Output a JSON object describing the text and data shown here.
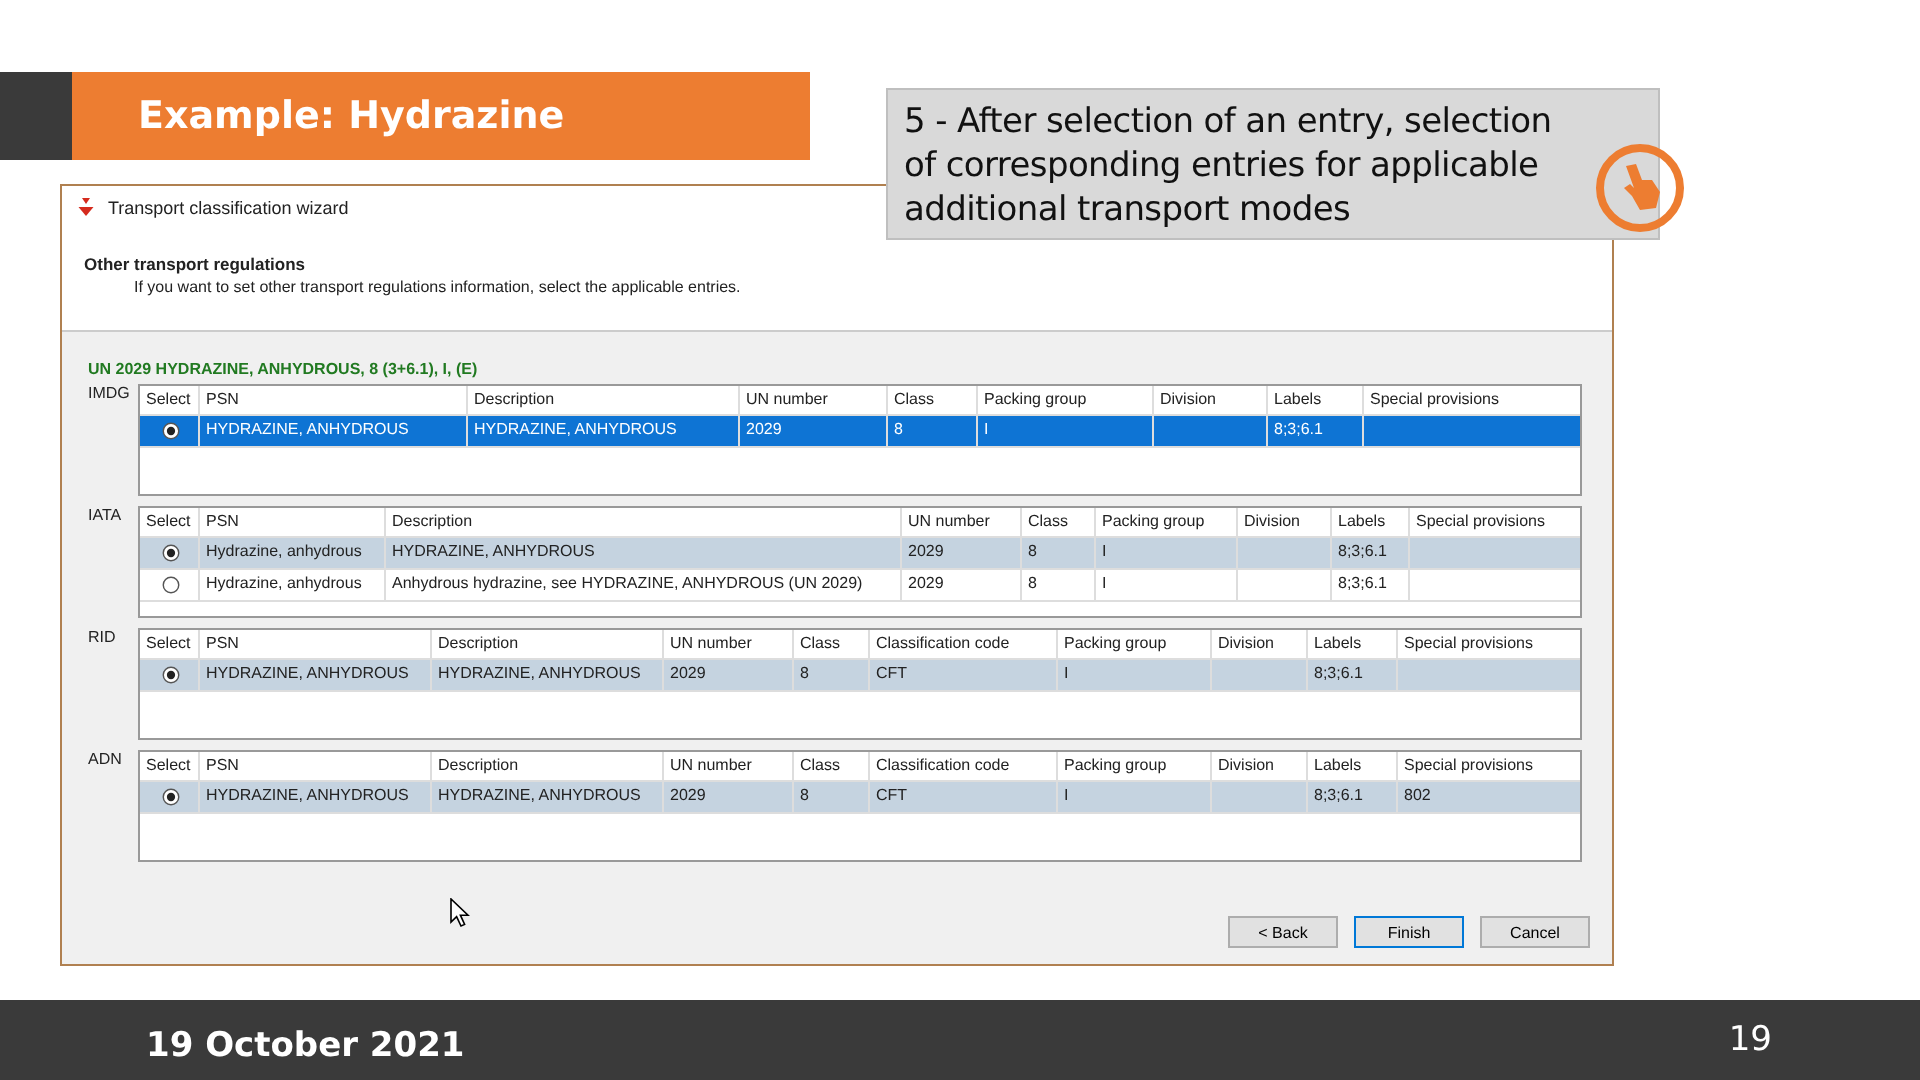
{
  "slide": {
    "title": "Example: Hydrazine",
    "callout": "5 - After selection of an entry, selection of corresponding entries for applicable additional transport modes",
    "date": "19 October 2021",
    "page_number": "19"
  },
  "wizard": {
    "title": "Transport classification wizard",
    "heading": "Other transport regulations",
    "instruction": "If you want to set other transport regulations information, select the applicable entries.",
    "entry": "UN 2029 HYDRAZINE, ANHYDROUS, 8 (3+6.1), I, (E)",
    "tables": [
      {
        "label": "IMDG",
        "focused": true,
        "select_column": "Select",
        "columns": [
          "PSN",
          "Description",
          "UN number",
          "Class",
          "Packing group",
          "Division",
          "Labels",
          "Special provisions"
        ],
        "rows": [
          {
            "selected": true,
            "cells": [
              "HYDRAZINE, ANHYDROUS",
              "HYDRAZINE, ANHYDROUS",
              "2029",
              "8",
              "I",
              null,
              "8;3;6.1",
              null
            ]
          }
        ]
      },
      {
        "label": "IATA",
        "focused": false,
        "select_column": "Select",
        "columns": [
          "PSN",
          "Description",
          "UN number",
          "Class",
          "Packing group",
          "Division",
          "Labels",
          "Special provisions"
        ],
        "rows": [
          {
            "selected": true,
            "cells": [
              "Hydrazine, anhydrous",
              "HYDRAZINE, ANHYDROUS",
              "2029",
              "8",
              "I",
              null,
              "8;3;6.1",
              null
            ]
          },
          {
            "selected": false,
            "cells": [
              "Hydrazine, anhydrous",
              "Anhydrous hydrazine, see HYDRAZINE, ANHYDROUS (UN 2029)",
              "2029",
              "8",
              "I",
              null,
              "8;3;6.1",
              null
            ]
          }
        ]
      },
      {
        "label": "RID",
        "focused": false,
        "select_column": "Select",
        "columns": [
          "PSN",
          "Description",
          "UN number",
          "Class",
          "Classification code",
          "Packing group",
          "Division",
          "Labels",
          "Special provisions"
        ],
        "rows": [
          {
            "selected": true,
            "cells": [
              "HYDRAZINE, ANHYDROUS",
              "HYDRAZINE, ANHYDROUS",
              "2029",
              "8",
              "CFT",
              "I",
              null,
              "8;3;6.1",
              null
            ]
          }
        ]
      },
      {
        "label": "ADN",
        "focused": false,
        "select_column": "Select",
        "columns": [
          "PSN",
          "Description",
          "UN number",
          "Class",
          "Classification code",
          "Packing group",
          "Division",
          "Labels",
          "Special provisions"
        ],
        "rows": [
          {
            "selected": true,
            "cells": [
              "HYDRAZINE, ANHYDROUS",
              "HYDRAZINE, ANHYDROUS",
              "2029",
              "8",
              "CFT",
              "I",
              null,
              "8;3;6.1",
              "802"
            ]
          }
        ]
      }
    ],
    "buttons": [
      {
        "label": "< Back",
        "default": false
      },
      {
        "label": "Finish",
        "default": true
      },
      {
        "label": "Cancel",
        "default": false
      }
    ]
  }
}
